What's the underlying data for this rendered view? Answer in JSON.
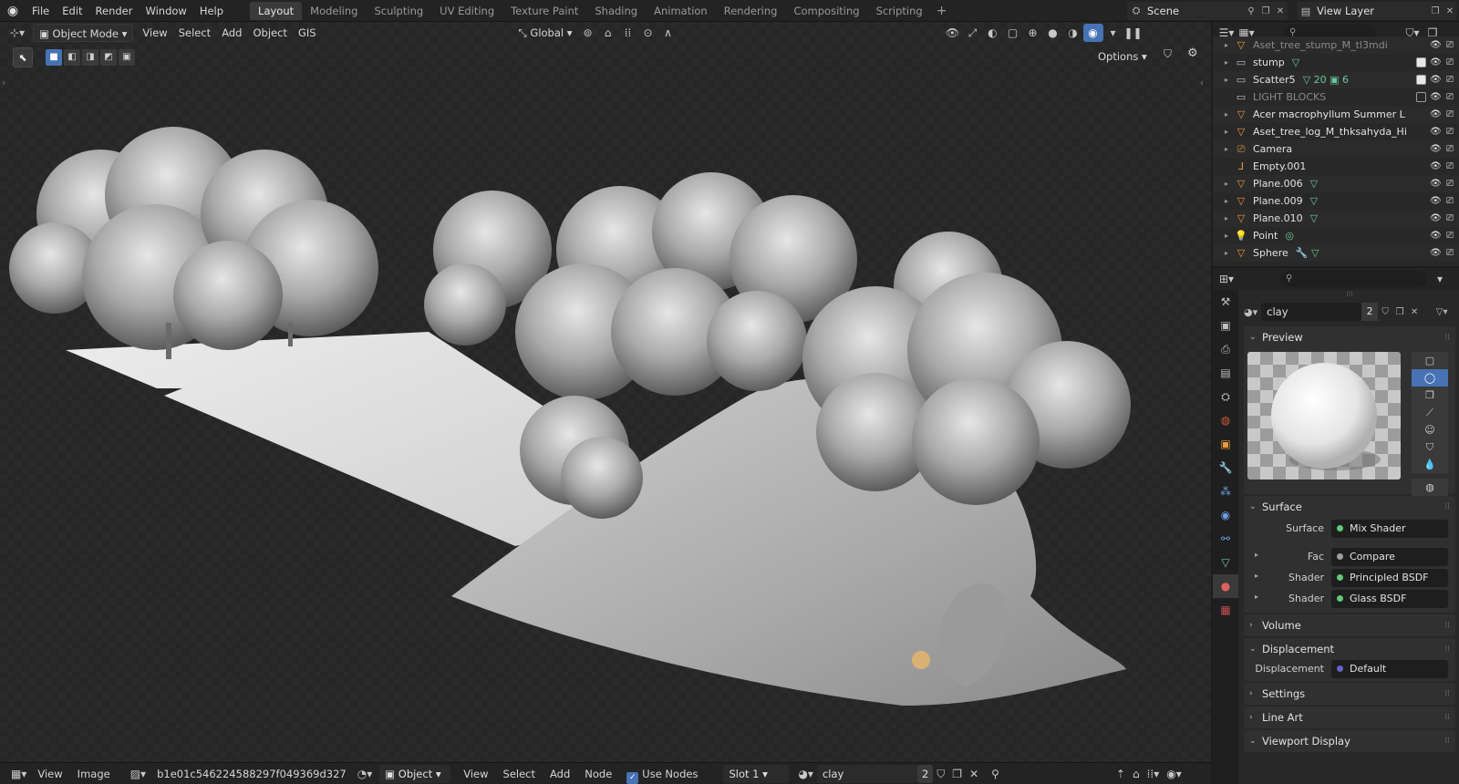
{
  "menu": [
    "File",
    "Edit",
    "Render",
    "Window",
    "Help"
  ],
  "workspaces": [
    "Layout",
    "Modeling",
    "Sculpting",
    "UV Editing",
    "Texture Paint",
    "Shading",
    "Animation",
    "Rendering",
    "Compositing",
    "Scripting"
  ],
  "active_workspace": "Layout",
  "scene": "Scene",
  "view_layer": "View Layer",
  "viewport": {
    "mode": "Object Mode",
    "menus": [
      "View",
      "Select",
      "Add",
      "Object",
      "GIS"
    ],
    "transform_orientation": "Global",
    "options": "Options"
  },
  "outliner": {
    "rows": [
      {
        "name": "Aset_tree_stump_M_tl3mdi",
        "icon": "mesh-icon",
        "extra": "",
        "dim": true,
        "check": null
      },
      {
        "name": "stump",
        "icon": "collection-icon",
        "extra": "▽",
        "dim": false,
        "check": true
      },
      {
        "name": "Scatter5",
        "icon": "collection-icon",
        "extra": "▽ 20 ▣ 6",
        "dim": false,
        "check": true
      },
      {
        "name": "LIGHT BLOCKS",
        "icon": "collection-icon",
        "extra": "",
        "dim": true,
        "check": false
      },
      {
        "name": "Acer macrophyllum Summer L",
        "icon": "mesh-icon",
        "extra": "",
        "dim": false,
        "check": null
      },
      {
        "name": "Aset_tree_log_M_thksahyda_Hi",
        "icon": "mesh-icon",
        "extra": "",
        "dim": false,
        "check": null
      },
      {
        "name": "Camera",
        "icon": "camera-icon",
        "extra": "",
        "dim": false,
        "check": null
      },
      {
        "name": "Empty.001",
        "icon": "empty-icon",
        "extra": "",
        "dim": false,
        "check": null
      },
      {
        "name": "Plane.006",
        "icon": "mesh-icon",
        "extra": "▽",
        "dim": false,
        "check": null
      },
      {
        "name": "Plane.009",
        "icon": "mesh-icon",
        "extra": "▽",
        "dim": false,
        "check": null
      },
      {
        "name": "Plane.010",
        "icon": "mesh-icon",
        "extra": "▽",
        "dim": false,
        "check": null
      },
      {
        "name": "Point",
        "icon": "light-icon",
        "extra": "◎",
        "dim": false,
        "check": null
      },
      {
        "name": "Sphere",
        "icon": "mesh-icon",
        "extra": "🔧 ▽",
        "dim": false,
        "check": null
      }
    ]
  },
  "properties": {
    "material_name": "clay",
    "material_users": "2",
    "panels": {
      "preview": "Preview",
      "surface": "Surface",
      "volume": "Volume",
      "displacement": "Displacement",
      "settings": "Settings",
      "line_art": "Line Art",
      "viewport_display": "Viewport Display"
    },
    "surface_rows": [
      {
        "label": "Surface",
        "value": "Mix Shader",
        "socket": "green",
        "sub": false
      },
      {
        "label": "Fac",
        "value": "Compare",
        "socket": "gray",
        "sub": true
      },
      {
        "label": "Shader",
        "value": "Principled BSDF",
        "socket": "green",
        "sub": true
      },
      {
        "label": "Shader",
        "value": "Glass BSDF",
        "socket": "green",
        "sub": true
      }
    ],
    "displacement_row": {
      "label": "Displacement",
      "value": "Default"
    }
  },
  "bottombar": {
    "menus_left": [
      "View",
      "Image"
    ],
    "image_name": "b1e01c546224588297f049369d327",
    "object": "Object",
    "menus_right": [
      "View",
      "Select",
      "Add",
      "Node"
    ],
    "use_nodes": "Use Nodes",
    "slot": "Slot 1",
    "material": "clay",
    "material_users": "2"
  },
  "colors": {
    "accent": "#4772b3",
    "panel": "#303030",
    "header": "#232323"
  }
}
